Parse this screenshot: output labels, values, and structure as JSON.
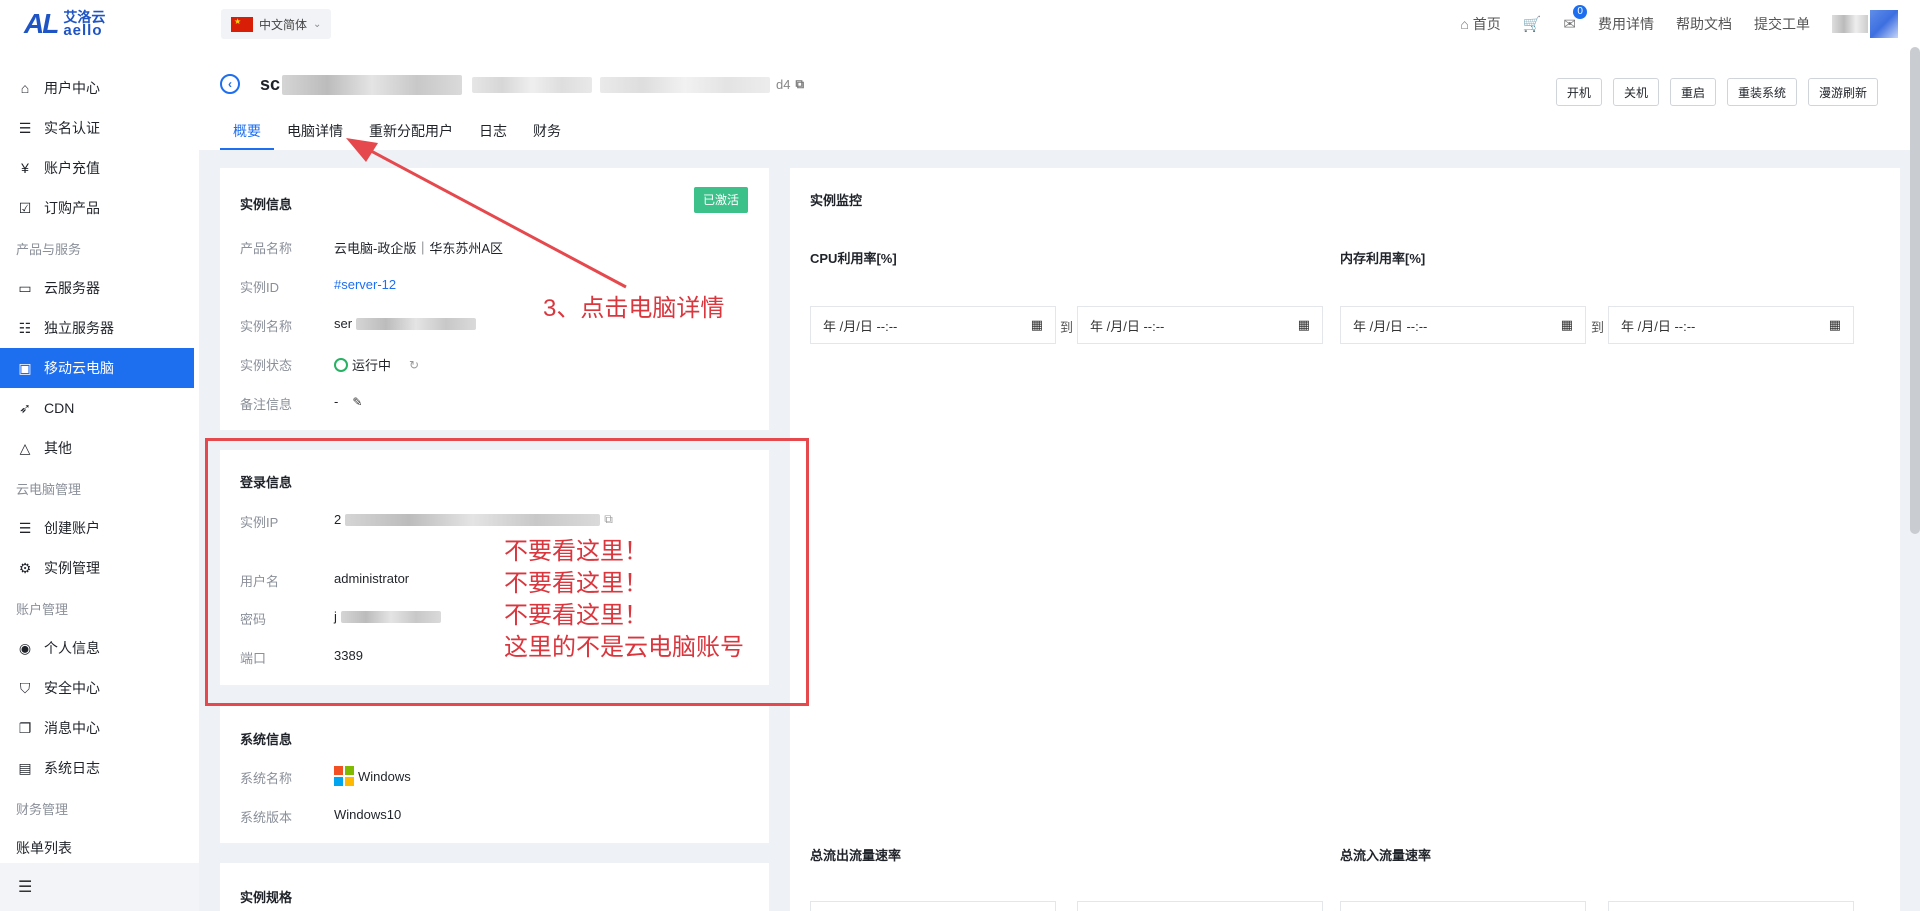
{
  "header": {
    "logo_mark": "AL",
    "logo_cn": "艾洛云",
    "logo_en": "aello",
    "language": "中文简体",
    "home": "首页",
    "message_count": "0",
    "billing": "费用详情",
    "help": "帮助文档",
    "ticket": "提交工单"
  },
  "sidebar": {
    "items": [
      {
        "label": "用户中心",
        "icon": "home-icon",
        "glyph": "⌂"
      },
      {
        "label": "实名认证",
        "icon": "id-card-icon",
        "glyph": "☰"
      },
      {
        "label": "账户充值",
        "icon": "yen-icon",
        "glyph": "¥"
      },
      {
        "label": "订购产品",
        "icon": "checklist-icon",
        "glyph": "☑"
      },
      {
        "label": "云服务器",
        "icon": "server-icon",
        "glyph": "▭"
      },
      {
        "label": "独立服务器",
        "icon": "dedicated-server-icon",
        "glyph": "☷"
      },
      {
        "label": "移动云电脑",
        "icon": "monitor-icon",
        "glyph": "▣"
      },
      {
        "label": "CDN",
        "icon": "rocket-icon",
        "glyph": "➶"
      },
      {
        "label": "其他",
        "icon": "triangle-icon",
        "glyph": "△"
      },
      {
        "label": "创建账户",
        "icon": "create-account-icon",
        "glyph": "☰"
      },
      {
        "label": "实例管理",
        "icon": "gear-icon",
        "glyph": "⚙"
      },
      {
        "label": "个人信息",
        "icon": "user-circle-icon",
        "glyph": "◉"
      },
      {
        "label": "安全中心",
        "icon": "shield-icon",
        "glyph": "⛉"
      },
      {
        "label": "消息中心",
        "icon": "message-icon",
        "glyph": "❐"
      },
      {
        "label": "系统日志",
        "icon": "file-icon",
        "glyph": "▤"
      },
      {
        "label": "账单列表",
        "icon": "",
        "glyph": ""
      }
    ],
    "groups": [
      "产品与服务",
      "云电脑管理",
      "账户管理",
      "财务管理"
    ],
    "collapse_glyph": "☰"
  },
  "page": {
    "title_prefix": "sc",
    "title_suffix": "d4",
    "actions": [
      "开机",
      "关机",
      "重启",
      "重装系统",
      "漫游刷新"
    ],
    "tabs": [
      "概要",
      "电脑详情",
      "重新分配用户",
      "日志",
      "财务"
    ]
  },
  "instance": {
    "title": "实例信息",
    "status_tag": "已激活",
    "product_label": "产品名称",
    "product_value": "云电脑-政企版｜华东苏州A区",
    "id_label": "实例ID",
    "id_value": "#server-12",
    "name_label": "实例名称",
    "name_value": "ser",
    "state_label": "实例状态",
    "state_value": "运行中",
    "note_label": "备注信息",
    "note_value": "-"
  },
  "login": {
    "title": "登录信息",
    "ip_label": "实例IP",
    "ip_value": "2",
    "user_label": "用户名",
    "user_value": "administrator",
    "pwd_label": "密码",
    "pwd_value": "j",
    "port_label": "端口",
    "port_value": "3389"
  },
  "system": {
    "title": "系统信息",
    "name_label": "系统名称",
    "name_value": "Windows",
    "version_label": "系统版本",
    "version_value": "Windows10"
  },
  "spec": {
    "title": "实例规格"
  },
  "monitor": {
    "title": "实例监控",
    "cpu": "CPU利用率[%]",
    "mem": "内存利用率[%]",
    "out_rate": "总流出流量速率",
    "in_rate": "总流入流量速率",
    "date_placeholder": "年 /月/日 --:--",
    "to": "到"
  },
  "annotations": {
    "step": "3、点击电脑详情",
    "warn_lines": [
      "不要看这里！",
      "不要看这里！",
      "不要看这里！",
      "这里的不是云电脑账号"
    ],
    "color": "#e5484d"
  }
}
